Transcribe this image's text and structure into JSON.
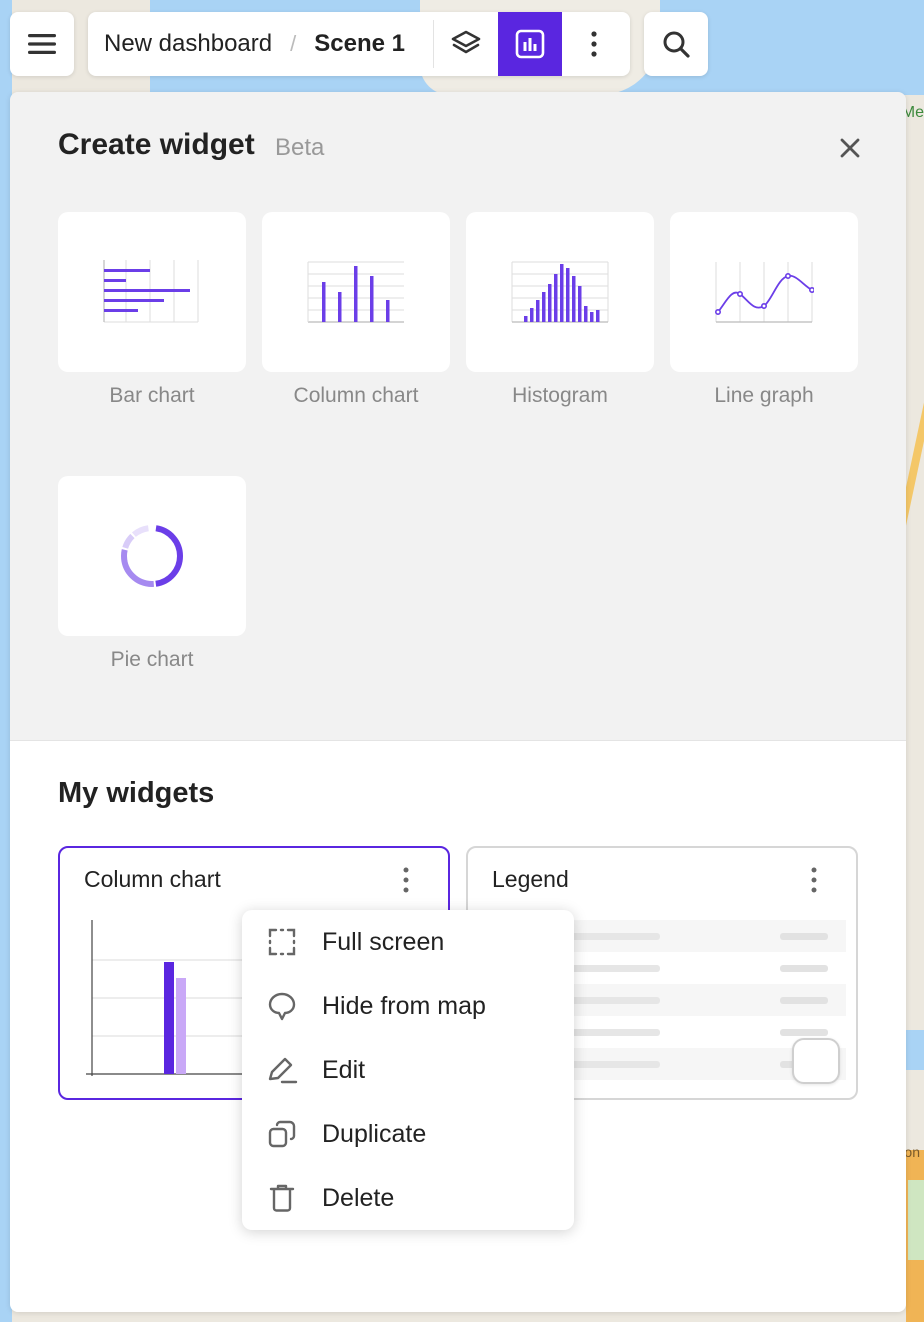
{
  "map": {
    "label_right": "Me",
    "label_right_bottom": "on"
  },
  "toolbar": {
    "breadcrumb": [
      "New dashboard",
      "Scene 1"
    ],
    "breadcrumb_separator": "/",
    "accent_color": "#5a26e0"
  },
  "create_widget": {
    "title": "Create widget",
    "badge": "Beta",
    "tiles": [
      {
        "label": "Bar chart",
        "icon": "bar-chart-icon"
      },
      {
        "label": "Column chart",
        "icon": "column-chart-icon"
      },
      {
        "label": "Histogram",
        "icon": "histogram-icon"
      },
      {
        "label": "Line graph",
        "icon": "line-graph-icon"
      },
      {
        "label": "Pie chart",
        "icon": "pie-chart-icon"
      }
    ]
  },
  "my_widgets": {
    "title": "My widgets",
    "widgets": [
      {
        "title": "Column chart",
        "selected": true
      },
      {
        "title": "Legend",
        "selected": false
      }
    ]
  },
  "context_menu": {
    "items": [
      {
        "label": "Full screen",
        "icon": "fullscreen-icon"
      },
      {
        "label": "Hide from map",
        "icon": "hide-from-map-icon"
      },
      {
        "label": "Edit",
        "icon": "edit-icon"
      },
      {
        "label": "Duplicate",
        "icon": "duplicate-icon"
      },
      {
        "label": "Delete",
        "icon": "delete-icon"
      }
    ]
  }
}
